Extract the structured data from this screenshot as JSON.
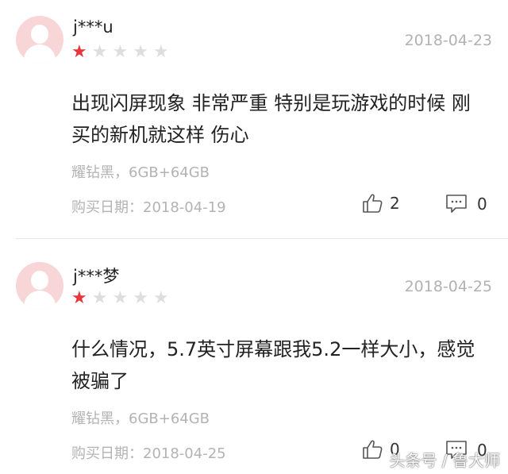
{
  "reviews": [
    {
      "username": "j***u",
      "date": "2018-04-23",
      "rating": 1,
      "content": "出现闪屏现象 非常严重 特别是玩游戏的时候 刚买的新机就这样 伤心",
      "spec": "耀钻黑，6GB+64GB",
      "purchase_date": "购买日期：2018-04-19",
      "likes": "2",
      "comments": "0"
    },
    {
      "username": "j***梦",
      "date": "2018-04-25",
      "rating": 1,
      "content": "什么情况，5.7英寸屏幕跟我5.2一样大小，感觉被骗了",
      "spec": "耀钻黑，6GB+64GB",
      "purchase_date": "购买日期：2018-04-25",
      "likes": "0",
      "comments": "0"
    }
  ],
  "watermark": "头条号 / 鲁大师",
  "colors": {
    "star_on": "#e8343b",
    "star_off": "#dedede",
    "avatar_bg": "#f8d6d8",
    "muted_text": "#b3b3b3"
  },
  "icons": {
    "like": "thumbs-up-icon",
    "comment": "comment-bubble-icon",
    "star": "star-icon",
    "avatar": "default-user-avatar-icon"
  }
}
